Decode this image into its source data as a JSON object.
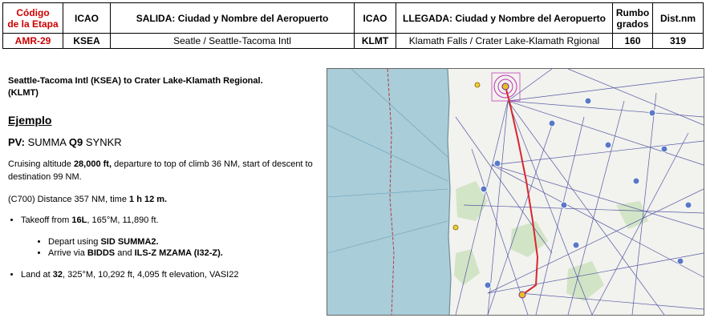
{
  "table": {
    "headers": {
      "stage_code_line1": "Código",
      "stage_code_line2": "de la Etapa",
      "icao_departure": "ICAO",
      "departure": "SALIDA: Ciudad y Nombre del Aeropuerto",
      "icao_arrival": "ICAO",
      "arrival": "LLEGADA: Ciudad y Nombre del Aeropuerto",
      "heading_line1": "Rumbo",
      "heading_line2": "grados",
      "distance": "Dist.nm"
    },
    "row": {
      "stage_code": "AMR-29",
      "icao_departure": "KSEA",
      "departure": "Seatle / Seattle-Tacoma Intl",
      "icao_arrival": "KLMT",
      "arrival": "Klamath Falls / Crater Lake-Klamath Rgional",
      "heading": "160",
      "distance": "319"
    }
  },
  "info": {
    "route_title_line1": "Seattle-Tacoma Intl (KSEA) to Crater Lake-Klamath Regional.",
    "route_title_line2": "(KLMT)",
    "example": "Ejemplo",
    "pv_label": "PV:",
    "pv_route_a": "SUMMA",
    "pv_route_b": "Q9",
    "pv_route_c": "SYNKR",
    "cruise_prefix": "Cruising altitude",
    "cruise_altitude": "28,000 ft,",
    "cruise_rest": "departure to top of climb 36 NM, start of descent to destination 99 NM.",
    "distance_prefix": "(C700) Distance 357 NM, time",
    "distance_time": "1 h 12 m.",
    "takeoff_prefix": "Takeoff from",
    "takeoff_runway": "16L",
    "takeoff_rest": ", 165°M, 11,890 ft.",
    "depart_prefix": "Depart using",
    "depart_sid": "SID SUMMA2.",
    "arrive_prefix": "Arrive via",
    "arrive_fix": "BIDDS",
    "arrive_and": "and",
    "arrive_approach": "ILS-Z MZAMA (I32-Z).",
    "land_prefix": "Land at",
    "land_runway": "32",
    "land_rest": ", 325°M, 10,292 ft, 4,095 ft elevation, VASI22"
  },
  "map": {
    "colors": {
      "ocean": "#a9cdd9",
      "land": "#f2f2ee",
      "route": "#d8262e",
      "airways": "#3a3f9a",
      "class_b": "#c033b4"
    }
  }
}
